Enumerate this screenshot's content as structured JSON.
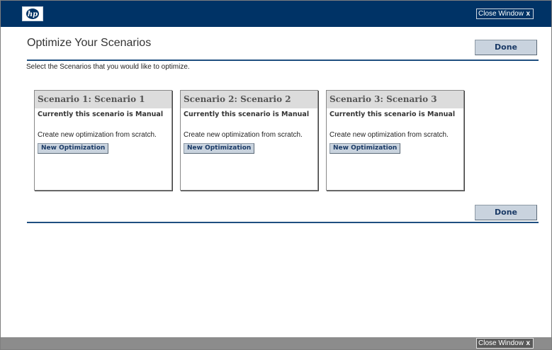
{
  "header": {
    "logo_icon": "hp-logo",
    "close_window_label": "Close Window",
    "close_icon": "close-x-icon",
    "close_glyph": "x"
  },
  "main": {
    "title": "Optimize Your Scenarios",
    "done_label": "Done",
    "instructions": "Select the Scenarios that you would like to optimize.",
    "scenarios": [
      {
        "title": "Scenario 1: Scenario 1",
        "status": "Currently this scenario is Manual",
        "description": "Create new optimization from scratch.",
        "button_label": "New Optimization"
      },
      {
        "title": "Scenario 2: Scenario 2",
        "status": "Currently this scenario is Manual",
        "description": "Create new optimization from scratch.",
        "button_label": "New Optimization"
      },
      {
        "title": "Scenario 3: Scenario 3",
        "status": "Currently this scenario is Manual",
        "description": "Create new optimization from scratch.",
        "button_label": "New Optimization"
      }
    ]
  },
  "footer": {
    "close_window_label": "Close Window",
    "close_glyph": "x"
  },
  "colors": {
    "header_bar": "#003366",
    "footer_bar": "#8c8c8c",
    "button_face": "#c9d3de",
    "rule": "#1f4f80"
  }
}
